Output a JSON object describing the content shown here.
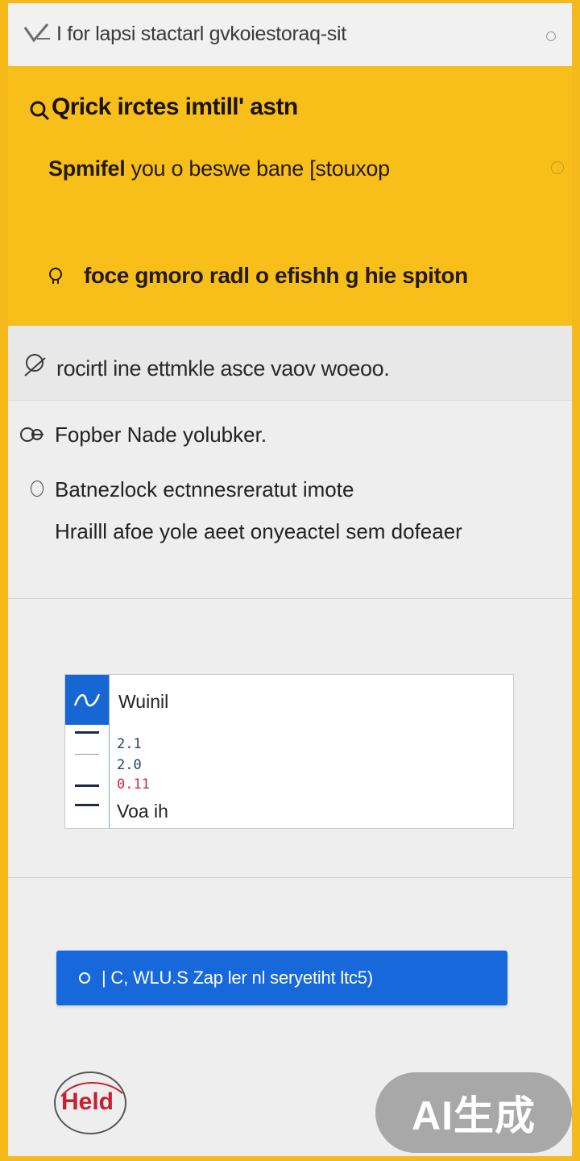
{
  "header": {
    "title": "I for lapsi stactarl gvkoiestoraq-sit",
    "logo_icon": "pen-check-icon",
    "menu_icon": "circle-icon"
  },
  "banner": {
    "background": "#f8bf1a",
    "heading": "Qrick irctes imtill' astn",
    "subtitle_bold": "Spmifel",
    "subtitle_rest": "you o beswe bane [stouxop",
    "action_text": "foce gmoro radl o efishh g hie spiton",
    "action_icon": "lightbulb-icon"
  },
  "search": {
    "text": "rocirtl ine ettmkle asce vaov woeoo.",
    "icon": "search-icon"
  },
  "info": {
    "line1": "Fopber Nade yolubker.",
    "line2": "Batnezlock ectnnesreratut imote",
    "line3": "Hrailll afoe yole aeet onyeactel sem dofeaer"
  },
  "card": {
    "title": "Wuinil",
    "values": [
      "2.1",
      "2.0",
      "0.11"
    ],
    "footer": "Voa ih",
    "accent": "#1667d3",
    "alert_color": "#d2283b"
  },
  "button": {
    "label": "| C, WLU.S Zap ler nl seryetiht ltc5)",
    "color": "#1768db"
  },
  "footer": {
    "logo_text": "Held",
    "watermark": "AI生成"
  }
}
